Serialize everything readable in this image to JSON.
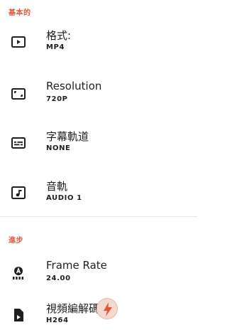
{
  "sections": {
    "basic_label": "基本的",
    "advanced_label": "進步"
  },
  "settings": {
    "format": {
      "title": "格式:",
      "value": "MP4",
      "icon": "play-box-icon"
    },
    "resolution": {
      "title": "Resolution",
      "value": "720P",
      "icon": "resolution-frame-icon"
    },
    "subtitles": {
      "title": "字幕軌道",
      "value": "NONE",
      "icon": "subtitles-icon"
    },
    "audio": {
      "title": "音軌",
      "value": "AUDIO 1",
      "icon": "music-note-icon"
    },
    "frame_rate": {
      "title": "Frame Rate",
      "value": "24.00",
      "icon": "frame-rate-icon"
    },
    "codec": {
      "title": "視頻編解碼器",
      "value": "H264",
      "icon": "video-file-icon"
    }
  },
  "colors": {
    "accent": "#e2553f",
    "text": "#1f1f1f",
    "divider": "#e6e6e6"
  }
}
